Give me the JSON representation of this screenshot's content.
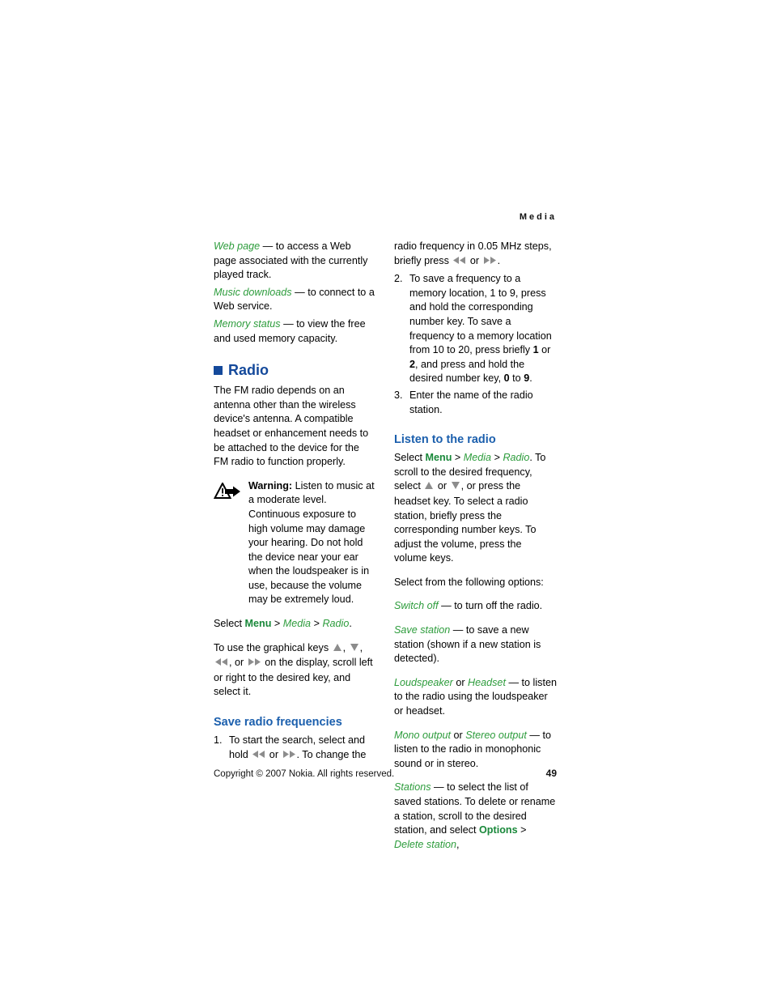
{
  "running_head": "Media",
  "footer": {
    "copyright": "Copyright © 2007 Nokia. All rights reserved.",
    "page_number": "49"
  },
  "left_column": {
    "definitions": [
      {
        "term": "Web page",
        "dash": " — ",
        "description": "to access a Web page associated with the currently played track."
      },
      {
        "term": "Music downloads",
        "dash": " — ",
        "description": "to connect to a Web service."
      },
      {
        "term": "Memory status",
        "dash": " — ",
        "description": "to view the free and used memory capacity."
      }
    ],
    "radio_heading": "Radio",
    "radio_intro": "The FM radio depends on an antenna other than the wireless device's antenna. A compatible headset or enhancement needs to be attached to the device for the FM radio to function properly.",
    "warning": {
      "icon": "warning-triangle-arrow-icon",
      "label": "Warning:",
      "text": " Listen to music at a moderate level. Continuous exposure to high volume may damage your hearing. Do not hold the device near your ear when the loudspeaker is in use, because the volume may be extremely loud."
    },
    "select_path": {
      "prefix": "Select ",
      "menu": "Menu",
      "sep1": " > ",
      "media": "Media",
      "sep2": " > ",
      "radio": "Radio",
      "suffix": "."
    },
    "graphical_keys_text_1": "To use the graphical keys ",
    "graphical_keys_text_2": ", ",
    "graphical_keys_text_3": ", or ",
    "graphical_keys_text_4": " on the display, scroll left or right to the desired key, and select it.",
    "save_heading": "Save radio frequencies",
    "save_steps": [
      {
        "number": "1.",
        "text_1": "To start the search, select and hold ",
        "text_2": " or ",
        "text_3": ". To change the"
      }
    ]
  },
  "right_column": {
    "continued_step1": "radio frequency in 0.05 MHz steps, briefly press ",
    "continued_step1_mid": " or ",
    "continued_step1_end": ".",
    "steps": [
      {
        "number": "2.",
        "part_a": "To save a frequency to a memory location, 1 to 9, press and hold the corresponding number key. To save a frequency to a memory location from 10 to 20, press briefly ",
        "bold_1": "1",
        "part_b": " or ",
        "bold_2": "2",
        "part_c": ", and press and hold the desired number key, ",
        "bold_3": "0",
        "part_d": " to ",
        "bold_4": "9",
        "part_e": "."
      },
      {
        "number": "3.",
        "part_a": "Enter the name of the radio station."
      }
    ],
    "listen_heading": "Listen to the radio",
    "listen_select": {
      "prefix": "Select ",
      "menu": "Menu",
      "sep1": " > ",
      "media": "Media",
      "sep2": " > ",
      "radio": "Radio",
      "after": ". To scroll to the desired frequency, select "
    },
    "listen_text_2": " or ",
    "listen_text_3": ", or press the headset key. To select a radio station, briefly press the corresponding number keys. To adjust the volume, press the volume keys.",
    "options_intro": "Select from the following options:",
    "options": [
      {
        "term": "Switch off",
        "dash": " — ",
        "description": "to turn off the radio."
      },
      {
        "term": "Save station",
        "dash": " — ",
        "description": "to save a new station (shown if a new station is detected)."
      },
      {
        "term": "Loudspeaker",
        "conjunction": " or ",
        "term2": "Headset",
        "dash": " — ",
        "description": "to listen to the radio using the loudspeaker or headset."
      },
      {
        "term": "Mono output",
        "conjunction": " or ",
        "term2": "Stereo output",
        "dash": " — ",
        "description": "to listen to the radio in monophonic sound or in stereo."
      },
      {
        "term": "Stations",
        "dash": " — ",
        "description_a": "to select the list of saved stations. To delete or rename a station, scroll to the desired station, and select ",
        "options_cmd": "Options",
        "sep": " > ",
        "delete_cmd": "Delete station",
        "description_b": ","
      }
    ]
  },
  "colors": {
    "heading_blue": "#14499b",
    "subheading_blue": "#1b5fad",
    "term_green": "#2d9c3c",
    "command_green": "#19883a",
    "icon_gray": "#8c8c8c"
  }
}
